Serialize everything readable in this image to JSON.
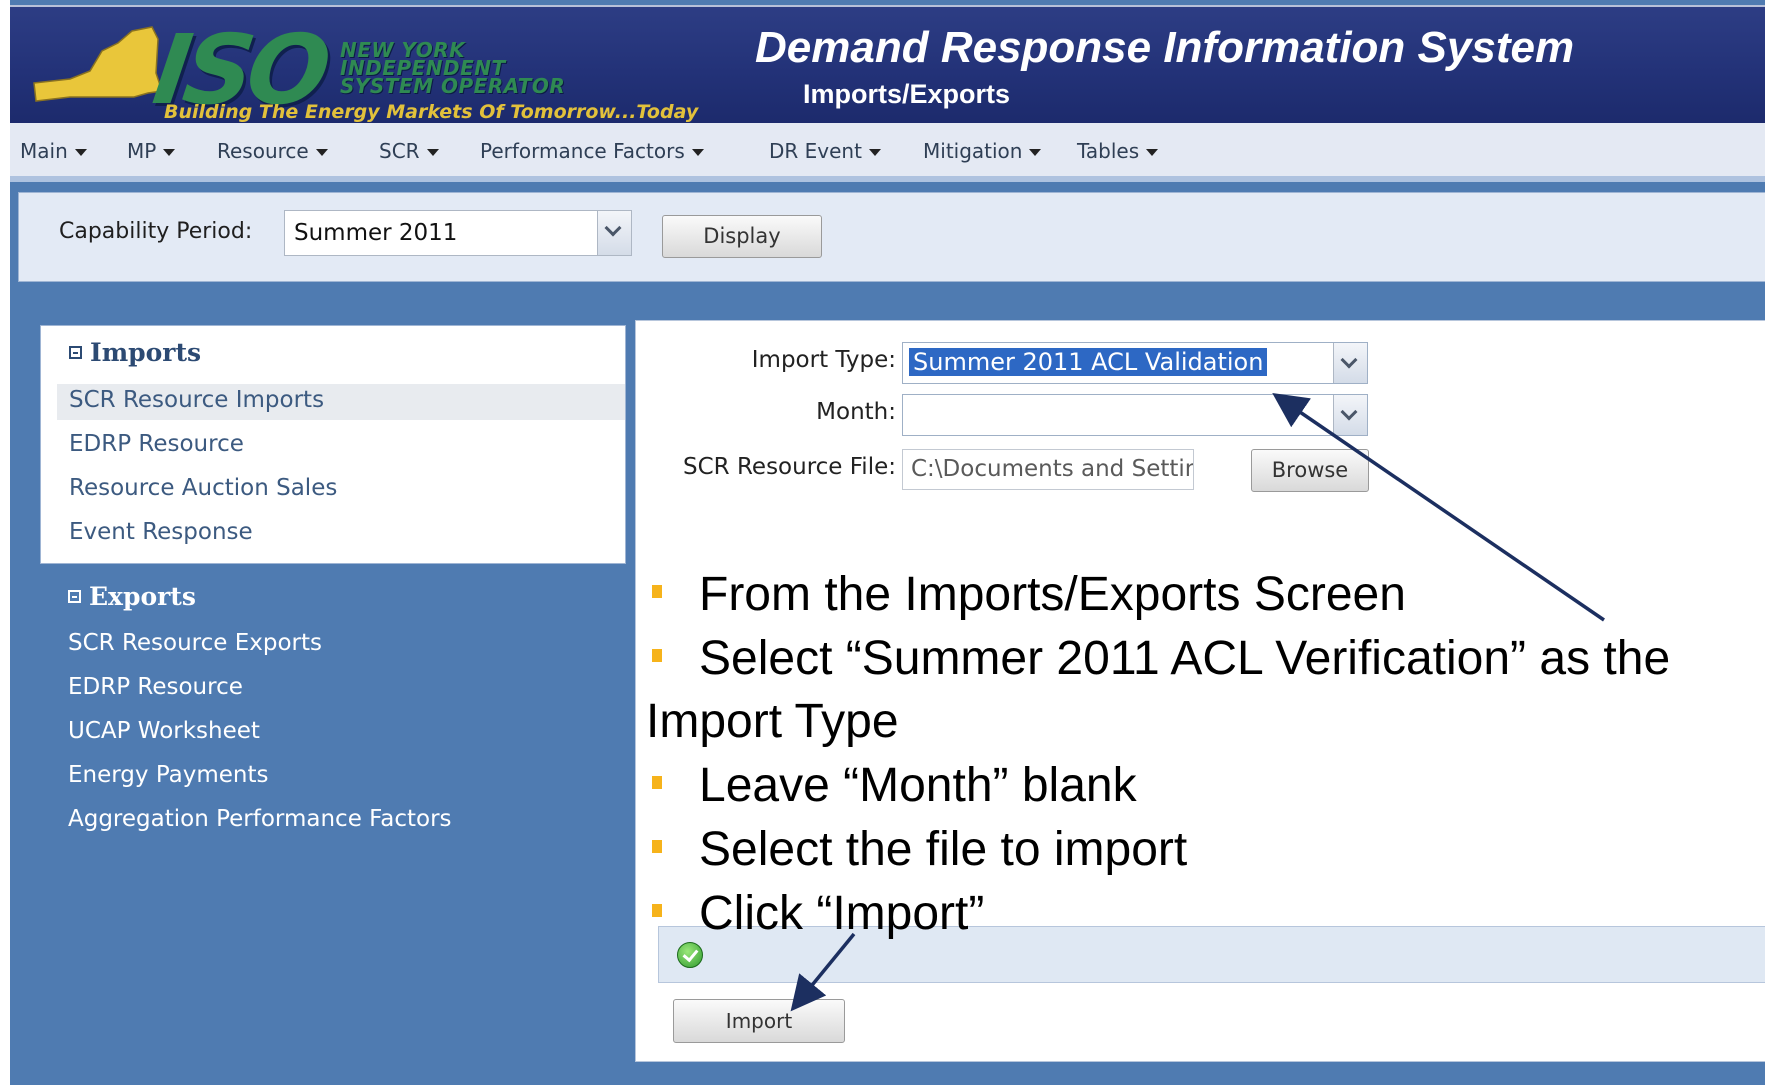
{
  "header": {
    "logo_letters": "ISO",
    "logo_name_lines": [
      "NEW YORK",
      "INDEPENDENT",
      "SYSTEM OPERATOR"
    ],
    "logo_tagline": "Building The Energy Markets Of Tomorrow...Today",
    "app_title": "Demand Response Information System",
    "page_subtitle": "Imports/Exports"
  },
  "menu": [
    "Main",
    "MP",
    "Resource",
    "SCR",
    "Performance Factors",
    "DR Event",
    "Mitigation",
    "Tables"
  ],
  "capability": {
    "label": "Capability Period:",
    "selected": "Summer 2011",
    "display_button": "Display"
  },
  "nav": {
    "imports_heading": "Imports",
    "imports_items": [
      "SCR Resource Imports",
      "EDRP Resource",
      "Resource Auction Sales",
      "Event Response"
    ],
    "exports_heading": "Exports",
    "exports_items": [
      "SCR Resource Exports",
      "EDRP Resource",
      "UCAP Worksheet",
      "Energy Payments",
      "Aggregation Performance Factors"
    ]
  },
  "form": {
    "import_type_label": "Import Type:",
    "import_type_value": "Summer 2011 ACL Validation",
    "month_label": "Month:",
    "month_value": "",
    "file_label": "SCR Resource File:",
    "file_value": "C:\\Documents and Settings",
    "browse_button": "Browse",
    "import_button": "Import"
  },
  "instructions": [
    "From the Imports/Exports Screen",
    "Select “Summer 2011 ACL Verification” as the",
    "Import Type",
    "Leave “Month” blank",
    "Select the file to import",
    "Click “Import”"
  ],
  "colors": {
    "header_bg": "#233278",
    "page_bg": "#4f7bb1",
    "logo_green": "#2f8a52",
    "tagline_gold": "#e2c13b",
    "bullet": "#f6b31b",
    "arrow": "#1c2f60"
  },
  "icons": {
    "status": "success-check-icon",
    "dropdown": "chevron-down-icon",
    "collapse": "minus-box-icon"
  }
}
